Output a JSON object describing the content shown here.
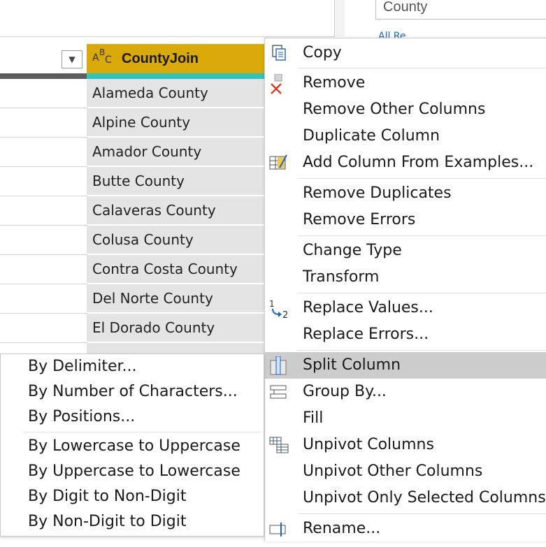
{
  "filter_panel": {
    "search_value": "County",
    "link_text": "All Re..."
  },
  "grid": {
    "column_header": "CountyJoin",
    "type_icon": "ABC-text-type-icon",
    "rows": [
      "Alameda County",
      "Alpine County",
      "Amador County",
      "Butte County",
      "Calaveras County",
      "Colusa County",
      "Contra Costa County",
      "Del Norte County",
      "El Dorado County"
    ]
  },
  "context_menu": {
    "items": [
      {
        "label": "Copy",
        "icon": "copy-icon"
      },
      {
        "label": "Remove",
        "icon": "remove-column-icon"
      },
      {
        "label": "Remove Other Columns",
        "icon": ""
      },
      {
        "label": "Duplicate Column",
        "icon": ""
      },
      {
        "label": "Add Column From Examples...",
        "icon": "add-column-examples-icon"
      },
      {
        "label": "Remove Duplicates",
        "icon": ""
      },
      {
        "label": "Remove Errors",
        "icon": ""
      },
      {
        "label": "Change Type",
        "icon": ""
      },
      {
        "label": "Transform",
        "icon": ""
      },
      {
        "label": "Replace Values...",
        "icon": "replace-values-icon"
      },
      {
        "label": "Replace Errors...",
        "icon": ""
      },
      {
        "label": "Split Column",
        "icon": "split-column-icon"
      },
      {
        "label": "Group By...",
        "icon": "group-by-icon"
      },
      {
        "label": "Fill",
        "icon": ""
      },
      {
        "label": "Unpivot Columns",
        "icon": "unpivot-icon"
      },
      {
        "label": "Unpivot Other Columns",
        "icon": ""
      },
      {
        "label": "Unpivot Only Selected Columns",
        "icon": ""
      },
      {
        "label": "Rename...",
        "icon": "rename-icon"
      }
    ],
    "highlighted": "Split Column"
  },
  "split_submenu": {
    "items": [
      "By Delimiter...",
      "By Number of Characters...",
      "By Positions...",
      "By Lowercase to Uppercase",
      "By Uppercase to Lowercase",
      "By Digit to Non-Digit",
      "By Non-Digit to Digit"
    ]
  },
  "colors": {
    "header_accent": "#d9a90a",
    "quality_bar": "#2fc3bb",
    "highlight": "#cccccc"
  }
}
